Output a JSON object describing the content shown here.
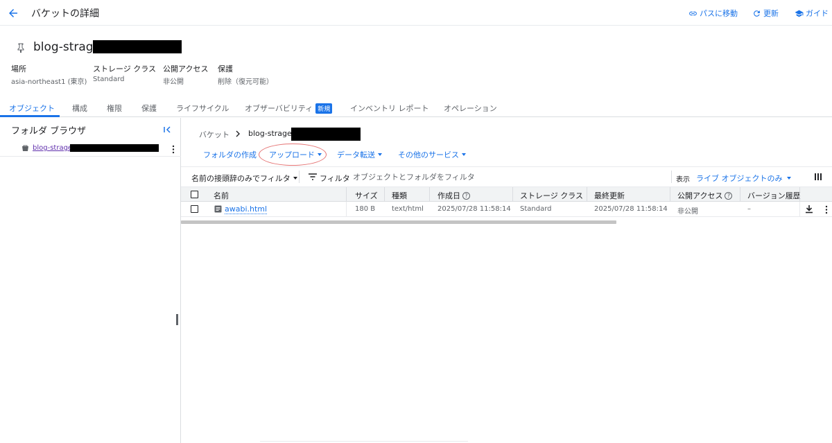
{
  "header": {
    "title": "バケットの詳細",
    "actions": {
      "goto_path": "パスに移動",
      "refresh": "更新",
      "guide": "ガイド"
    }
  },
  "bucket": {
    "name": "blog-strage",
    "meta": [
      {
        "label": "場所",
        "value": "asia-northeast1 (東京)"
      },
      {
        "label": "ストレージ クラス",
        "value": "Standard"
      },
      {
        "label": "公開アクセス",
        "value": "非公開"
      },
      {
        "label": "保護",
        "value": "削除（復元可能）"
      }
    ]
  },
  "tabs": [
    {
      "label": "オブジェクト",
      "active": true
    },
    {
      "label": "構成"
    },
    {
      "label": "権限"
    },
    {
      "label": "保護"
    },
    {
      "label": "ライフサイクル"
    },
    {
      "label": "オブザーバビリティ",
      "badge": "新規"
    },
    {
      "label": "インベントリ レポート"
    },
    {
      "label": "オペレーション"
    }
  ],
  "folder_browser": {
    "title": "フォルダ ブラウザ",
    "item_label": "blog-strage-"
  },
  "breadcrumb": {
    "root": "バケット",
    "current": "blog-strage-"
  },
  "actions": {
    "create_folder": "フォルダの作成",
    "upload": "アップロード",
    "transfer": "データ転送",
    "other_services": "その他のサービス"
  },
  "filter": {
    "prefix_only": "名前の接頭辞のみでフィルタ",
    "label": "フィルタ",
    "placeholder": "オブジェクトとフォルダをフィルタ",
    "view_label": "表示",
    "view_value": "ライブ オブジェクトのみ"
  },
  "table": {
    "columns": [
      "名前",
      "サイズ",
      "種類",
      "作成日",
      "ストレージ クラス",
      "最終更新",
      "公開アクセス",
      "バージョン履歴"
    ],
    "rows": [
      {
        "name": "awabi.html",
        "size": "180 B",
        "type": "text/html",
        "created": "2025/07/28 11:58:14",
        "storage_class": "Standard",
        "updated": "2025/07/28 11:58:14",
        "public_access": "非公開",
        "version_history": "–"
      }
    ]
  },
  "colors": {
    "accent": "#1a73e8",
    "highlight_ring": "#e57373"
  }
}
